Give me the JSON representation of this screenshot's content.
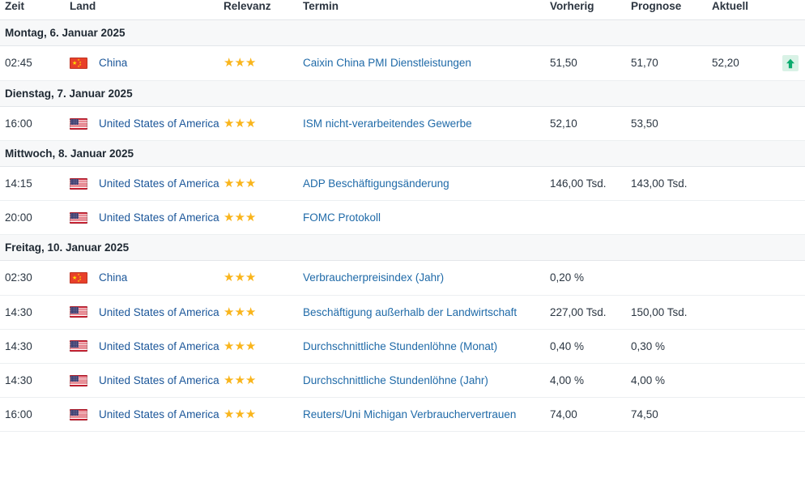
{
  "table": {
    "columns": [
      {
        "key": "zeit",
        "label": "Zeit"
      },
      {
        "key": "land",
        "label": "Land"
      },
      {
        "key": "relevanz",
        "label": "Relevanz"
      },
      {
        "key": "termin",
        "label": "Termin"
      },
      {
        "key": "vorherig",
        "label": "Vorherig"
      },
      {
        "key": "prognose",
        "label": "Prognose"
      },
      {
        "key": "aktuell",
        "label": "Aktuell"
      }
    ],
    "colors": {
      "link": "#1f6aa8",
      "country_link": "#1b5699",
      "star": "#f9b51c",
      "date_header_bg": "#f7f8f9",
      "row_border": "#eceff1",
      "arrow_up_green": "#0bab6e",
      "arrow_box_bg": "#d9f2e6",
      "text": "#2b3642"
    },
    "groups": [
      {
        "date_label": "Montag, 6. Januar 2025",
        "rows": [
          {
            "time": "02:45",
            "flag": "cn-flag-icon",
            "country": "China",
            "stars": 3,
            "event": "Caixin China PMI Dienstleistungen",
            "previous": "51,50",
            "forecast": "51,70",
            "actual": "52,20",
            "trend": "arrow-up-icon"
          }
        ]
      },
      {
        "date_label": "Dienstag, 7. Januar 2025",
        "rows": [
          {
            "time": "16:00",
            "flag": "us-flag-icon",
            "country": "United States of America",
            "stars": 3,
            "event": "ISM nicht-verarbeitendes Gewerbe",
            "previous": "52,10",
            "forecast": "53,50",
            "actual": "",
            "trend": ""
          }
        ]
      },
      {
        "date_label": "Mittwoch, 8. Januar 2025",
        "rows": [
          {
            "time": "14:15",
            "flag": "us-flag-icon",
            "country": "United States of America",
            "stars": 3,
            "event": "ADP Beschäftigungsänderung",
            "previous": "146,00 Tsd.",
            "forecast": "143,00 Tsd.",
            "actual": "",
            "trend": ""
          },
          {
            "time": "20:00",
            "flag": "us-flag-icon",
            "country": "United States of America",
            "stars": 3,
            "event": "FOMC Protokoll",
            "previous": "",
            "forecast": "",
            "actual": "",
            "trend": ""
          }
        ]
      },
      {
        "date_label": "Freitag, 10. Januar 2025",
        "rows": [
          {
            "time": "02:30",
            "flag": "cn-flag-icon",
            "country": "China",
            "stars": 3,
            "event": "Verbraucherpreisindex (Jahr)",
            "previous": "0,20 %",
            "forecast": "",
            "actual": "",
            "trend": ""
          },
          {
            "time": "14:30",
            "flag": "us-flag-icon",
            "country": "United States of America",
            "stars": 3,
            "event": "Beschäftigung außerhalb der Landwirtschaft",
            "previous": "227,00 Tsd.",
            "forecast": "150,00 Tsd.",
            "actual": "",
            "trend": ""
          },
          {
            "time": "14:30",
            "flag": "us-flag-icon",
            "country": "United States of America",
            "stars": 3,
            "event": "Durchschnittliche Stundenlöhne (Monat)",
            "previous": "0,40 %",
            "forecast": "0,30 %",
            "actual": "",
            "trend": ""
          },
          {
            "time": "14:30",
            "flag": "us-flag-icon",
            "country": "United States of America",
            "stars": 3,
            "event": "Durchschnittliche Stundenlöhne (Jahr)",
            "previous": "4,00 %",
            "forecast": "4,00 %",
            "actual": "",
            "trend": ""
          },
          {
            "time": "16:00",
            "flag": "us-flag-icon",
            "country": "United States of America",
            "stars": 3,
            "event": "Reuters/Uni Michigan Verbrauchervertrauen",
            "previous": "74,00",
            "forecast": "74,50",
            "actual": "",
            "trend": ""
          }
        ]
      }
    ]
  }
}
